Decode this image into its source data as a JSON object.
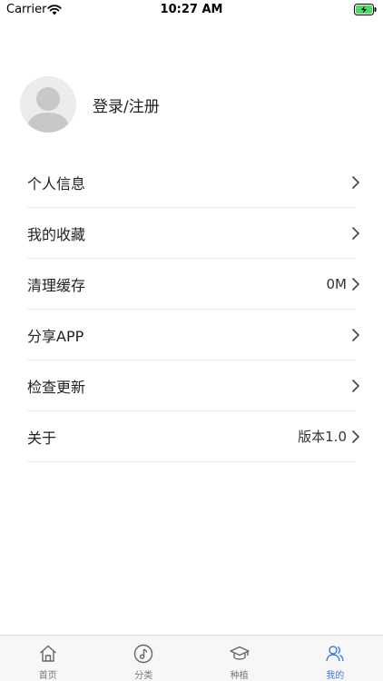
{
  "status_bar": {
    "carrier": "Carrier",
    "time": "10:27 AM"
  },
  "profile": {
    "login_label": "登录/注册"
  },
  "menu": [
    {
      "label": "个人信息",
      "value": ""
    },
    {
      "label": "我的收藏",
      "value": ""
    },
    {
      "label": "清理缓存",
      "value": "0M"
    },
    {
      "label": "分享APP",
      "value": ""
    },
    {
      "label": "检查更新",
      "value": ""
    },
    {
      "label": "关于",
      "value": "版本1.0"
    }
  ],
  "tabs": [
    {
      "label": "首页",
      "icon": "home-icon",
      "active": false
    },
    {
      "label": "分类",
      "icon": "music-note-icon",
      "active": false
    },
    {
      "label": "种植",
      "icon": "graduation-cap-icon",
      "active": false
    },
    {
      "label": "我的",
      "icon": "user-icon",
      "active": true
    }
  ],
  "colors": {
    "accent": "#3a7bea",
    "battery": "#4cd964"
  }
}
